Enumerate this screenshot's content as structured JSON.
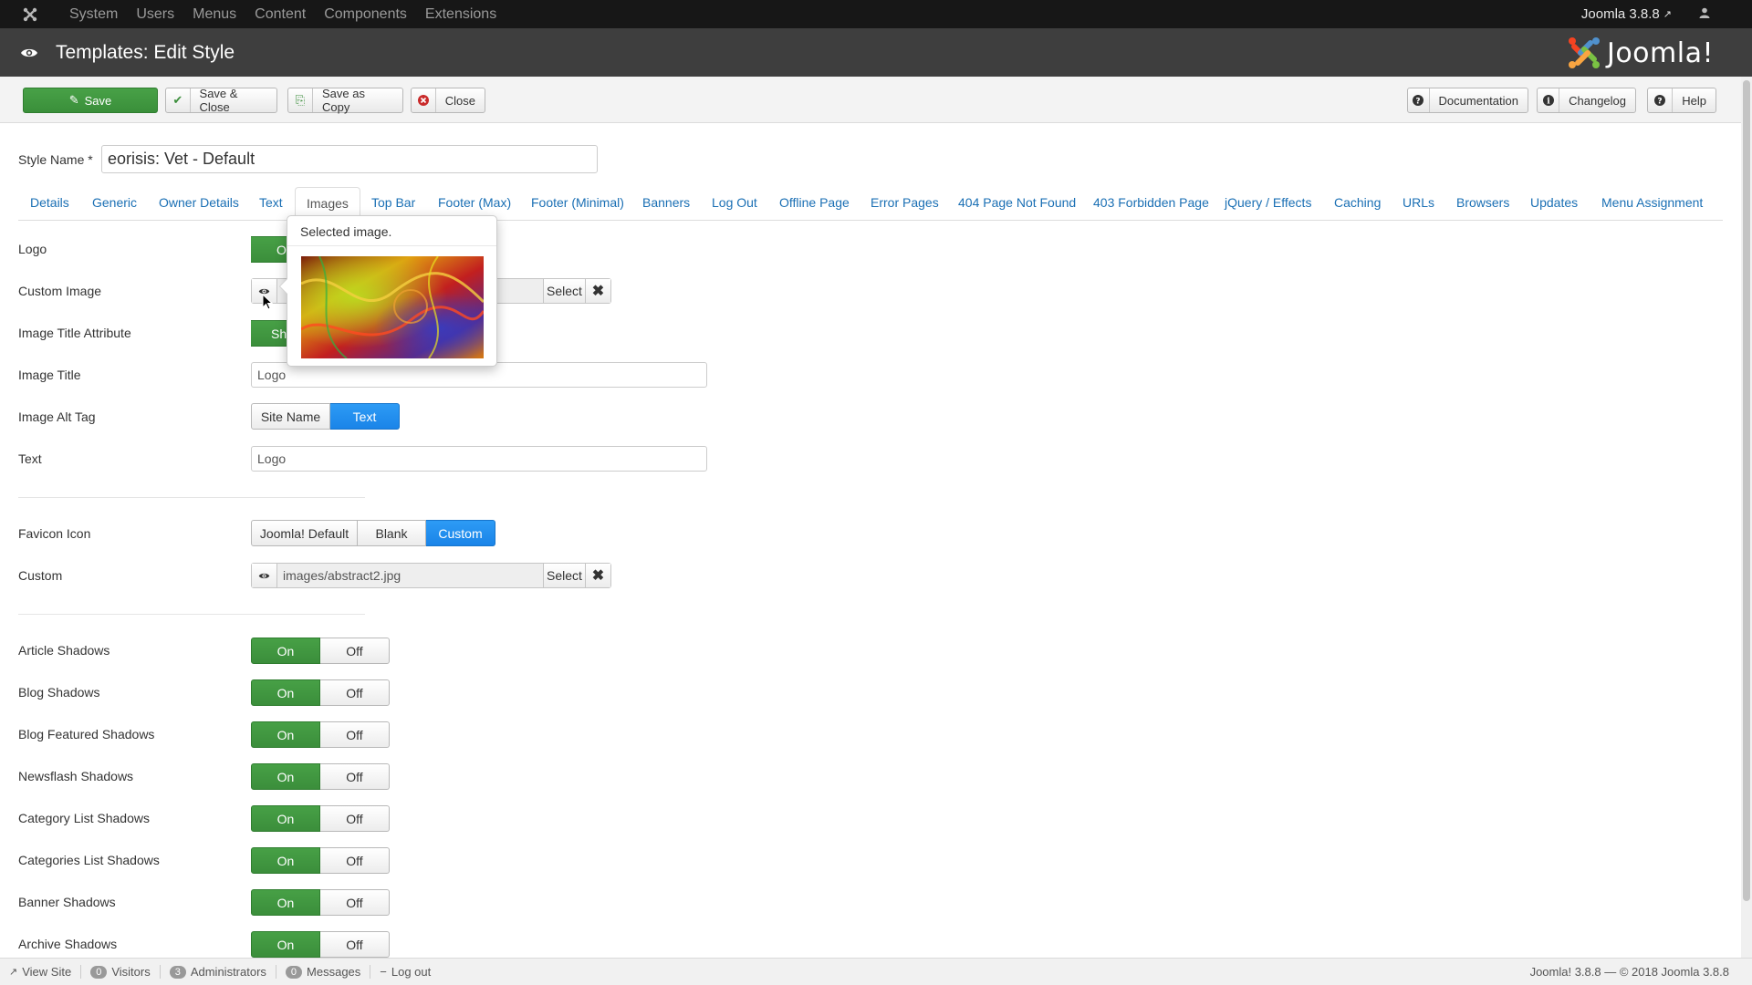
{
  "topnav": {
    "menu": [
      "System",
      "Users",
      "Menus",
      "Content",
      "Components",
      "Extensions"
    ],
    "version_link": "Joomla 3.8.8"
  },
  "titlebar": {
    "title": "Templates: Edit Style",
    "logo_text": "Joomla!"
  },
  "toolbar": {
    "save": "Save",
    "save_close": "Save & Close",
    "save_copy": "Save as Copy",
    "close": "Close",
    "documentation": "Documentation",
    "changelog": "Changelog",
    "help": "Help"
  },
  "style_name": {
    "label": "Style Name *",
    "value": "eorisis: Vet - Default"
  },
  "tabs": [
    "Details",
    "Generic",
    "Owner Details",
    "Text",
    "Images",
    "Top Bar",
    "Footer (Max)",
    "Footer (Minimal)",
    "Banners",
    "Log Out",
    "Offline Page",
    "Error Pages",
    "404 Page Not Found",
    "403 Forbidden Page",
    "jQuery / Effects",
    "Caching",
    "URLs",
    "Browsers",
    "Updates",
    "Menu Assignment"
  ],
  "active_tab": "Images",
  "form": {
    "logo": {
      "label": "Logo",
      "button_partial": "O"
    },
    "custom_image": {
      "label": "Custom Image",
      "select": "Select"
    },
    "image_title_attr": {
      "label": "Image Title Attribute",
      "button_partial": "Sh"
    },
    "image_title": {
      "label": "Image Title",
      "value": "Logo"
    },
    "image_alt_tag": {
      "label": "Image Alt Tag",
      "options": [
        "Site Name",
        "Text"
      ],
      "selected": "Text"
    },
    "text": {
      "label": "Text",
      "value": "Logo"
    },
    "favicon": {
      "label": "Favicon Icon",
      "options": [
        "Joomla! Default",
        "Blank",
        "Custom"
      ],
      "selected": "Custom"
    },
    "custom": {
      "label": "Custom",
      "path": "images/abstract2.jpg",
      "select": "Select"
    },
    "shadows": [
      {
        "label": "Article Shadows",
        "on": "On",
        "off": "Off"
      },
      {
        "label": "Blog Shadows",
        "on": "On",
        "off": "Off"
      },
      {
        "label": "Blog Featured Shadows",
        "on": "On",
        "off": "Off"
      },
      {
        "label": "Newsflash Shadows",
        "on": "On",
        "off": "Off"
      },
      {
        "label": "Category List Shadows",
        "on": "On",
        "off": "Off"
      },
      {
        "label": "Categories List Shadows",
        "on": "On",
        "off": "Off"
      },
      {
        "label": "Banner Shadows",
        "on": "On",
        "off": "Off"
      },
      {
        "label": "Archive Shadows",
        "on": "On",
        "off": "Off"
      }
    ]
  },
  "popover": {
    "title": "Selected image."
  },
  "statusbar": {
    "view_site": "View Site",
    "visitors_count": "0",
    "visitors": "Visitors",
    "admins_count": "3",
    "admins": "Administrators",
    "messages_count": "0",
    "messages": "Messages",
    "logout": "Log out",
    "copyright": "Joomla! 3.8.8 — © 2018 Joomla 3.8.8"
  },
  "colors": {
    "green": "#3f953f",
    "blue": "#2088ee",
    "link": "#1a6fb4",
    "title_bar": "#3e3e3e"
  }
}
